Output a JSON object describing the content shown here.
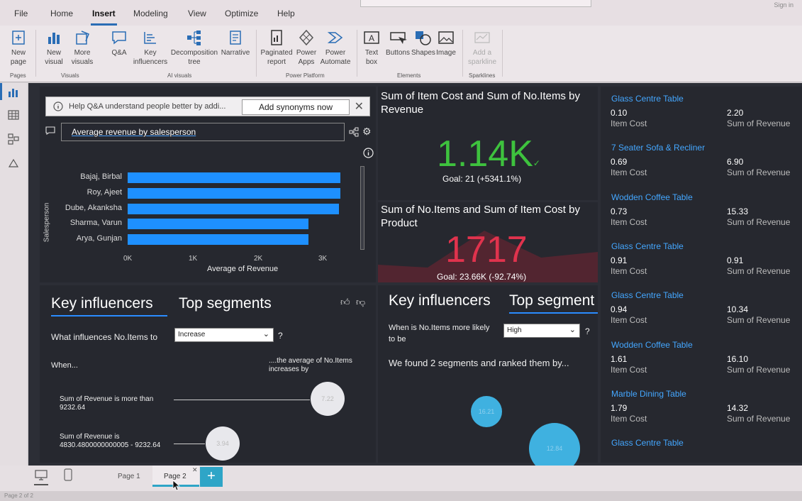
{
  "menu": {
    "file": "File",
    "home": "Home",
    "insert": "Insert",
    "modeling": "Modeling",
    "view": "View",
    "optimize": "Optimize",
    "help": "Help",
    "signin": "Sign in"
  },
  "ribbon": {
    "new_page": "New page",
    "new_visual": "New visual",
    "more_visuals": "More visuals",
    "qa": "Q&A",
    "key_influencers": "Key influencers",
    "decomposition_tree": "Decomposition tree",
    "narrative": "Narrative",
    "paginated_report": "Paginated report",
    "power_apps": "Power Apps",
    "power_automate": "Power Automate",
    "text_box": "Text box",
    "buttons": "Buttons",
    "shapes": "Shapes",
    "image": "Image",
    "add_sparkline": "Add a sparkline",
    "groups": {
      "pages": "Pages",
      "visuals": "Visuals",
      "ai_visuals": "AI visuals",
      "power_platform": "Power Platform",
      "elements": "Elements",
      "sparklines": "Sparklines"
    }
  },
  "qa": {
    "banner_text": "Help Q&A understand people better by addi...",
    "synonyms_button": "Add synonyms now",
    "question": "Average revenue by salesperson",
    "y_axis_label": "Salesperson",
    "x_axis_label": "Average of Revenue",
    "x_ticks": [
      "0K",
      "1K",
      "2K",
      "3K"
    ]
  },
  "chart_data": {
    "type": "bar",
    "orientation": "horizontal",
    "categories": [
      "Bajaj, Birbal",
      "Roy, Ajeet",
      "Dube, Akanksha",
      "Sharma, Varun",
      "Arya, Gunjan"
    ],
    "values": [
      3350,
      3250,
      3230,
      2760,
      2760
    ],
    "xlabel": "Average of Revenue",
    "ylabel": "Salesperson",
    "xlim": [
      0,
      3500
    ],
    "color": "#1e90ff"
  },
  "kpi1": {
    "title": "Sum of Item Cost and Sum of No.Items by Revenue",
    "value": "1.14K",
    "goal": "Goal: 21 (+5341.1%)",
    "color": "#3ec23e"
  },
  "kpi2": {
    "title": "Sum of No.Items and Sum of Item Cost by Product",
    "value": "1717",
    "goal": "Goal: 23.66K (-92.74%)",
    "color": "#e0334d"
  },
  "ki1": {
    "tab_active": "Key influencers",
    "tab_other": "Top segments",
    "question": "What influences No.Items to",
    "dropdown": "Increase",
    "when": "When...",
    "avg_label": "....the average of No.Items increases by",
    "factors": [
      {
        "text": "Sum of Revenue is more than 9232.64",
        "value": "7.22"
      },
      {
        "text": "Sum of Revenue is 4830.4800000000005 - 9232.64",
        "value": "3.94"
      }
    ]
  },
  "ki2": {
    "tab_other": "Key influencers",
    "tab_active": "Top segment",
    "question": "When is No.Items more likely to be",
    "dropdown": "High",
    "found": "We found 2 segments and ranked them by...",
    "bubbles": [
      "16.21",
      "12.84"
    ]
  },
  "table": {
    "rows": [
      {
        "name": "Glass Centre Table",
        "cost": "0.10",
        "revenue": "2.20"
      },
      {
        "name": "7 Seater Sofa & Recliner",
        "cost": "0.69",
        "revenue": "6.90"
      },
      {
        "name": "Wodden Coffee Table",
        "cost": "0.73",
        "revenue": "15.33"
      },
      {
        "name": "Glass Centre Table",
        "cost": "0.91",
        "revenue": "0.91"
      },
      {
        "name": "Glass Centre Table",
        "cost": "0.94",
        "revenue": "10.34"
      },
      {
        "name": "Wodden Coffee Table",
        "cost": "1.61",
        "revenue": "16.10"
      },
      {
        "name": "Marble Dining Table",
        "cost": "1.79",
        "revenue": "14.32"
      },
      {
        "name": "Glass Centre Table",
        "cost": "",
        "revenue": ""
      }
    ],
    "cost_label": "Item Cost",
    "revenue_label": "Sum of Revenue"
  },
  "pages": {
    "page1": "Page 1",
    "page2": "Page 2",
    "add": "+",
    "status": "Page 2 of 2"
  }
}
